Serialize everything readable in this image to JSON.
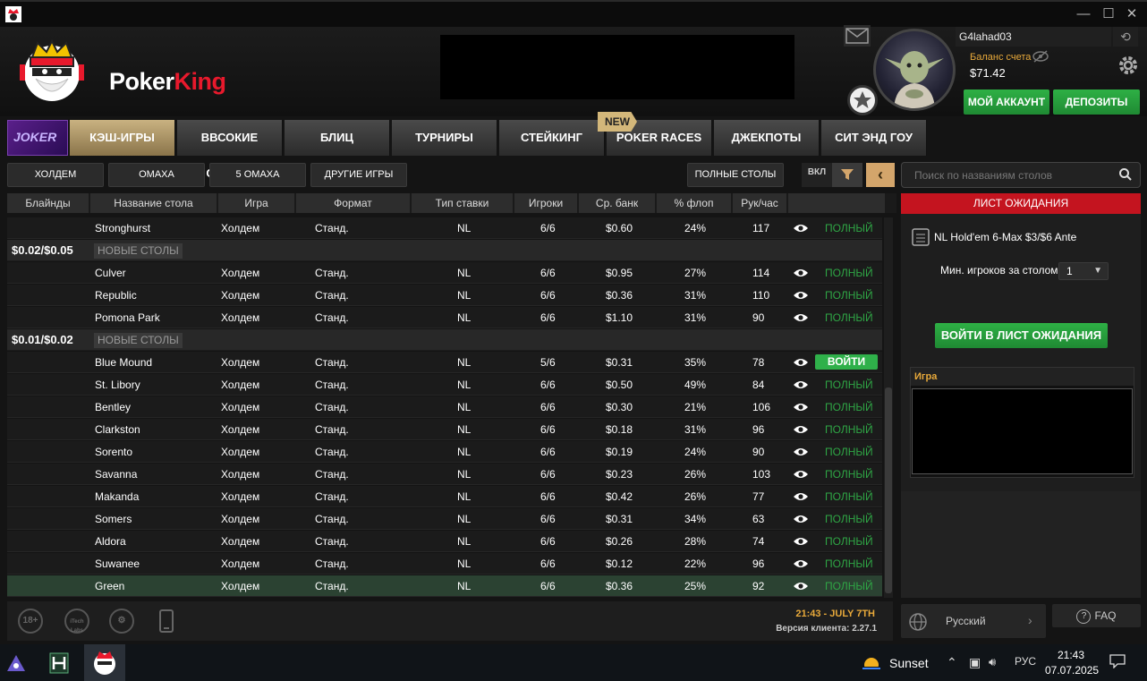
{
  "brand": {
    "name_white": "Poker",
    "name_red": "King"
  },
  "window": {
    "minimize": "—",
    "maximize": "☐",
    "close": "✕"
  },
  "account": {
    "username": "G4lahad03",
    "balance_label": "Баланс счета",
    "balance": "$71.42",
    "my_account": "МОЙ АККАУНТ",
    "deposits": "ДЕПОЗИТЫ"
  },
  "tabs": [
    {
      "label": "КЭШ-ИГРЫ",
      "active": true
    },
    {
      "label": "ВВСОКИЕ СТАВКИ"
    },
    {
      "label": "БЛИЦ"
    },
    {
      "label": "ТУРНИРЫ"
    },
    {
      "label": "СТЕЙКИНГ"
    },
    {
      "label": "POKER RACES",
      "badge": "NEW"
    },
    {
      "label": "ДЖЕКПОТЫ"
    },
    {
      "label": "СИТ ЭНД ГОУ"
    }
  ],
  "joker_label": "JOKER",
  "filters": {
    "holdem": "ХОЛДЕМ",
    "omaha": "ОМАХА",
    "omaha5": "5 ОМАХА",
    "other": "ДРУГИЕ ИГРЫ",
    "full_tables": "ПОЛНЫЕ СТОЛЫ",
    "toggle": "ВКЛ"
  },
  "search": {
    "placeholder": "Поиск по названиям столов"
  },
  "columns": [
    "Блайнды",
    "Название стола",
    "Игра",
    "Формат",
    "Тип ставки",
    "Игроки",
    "Ср. банк",
    "% флоп",
    "Рук/час"
  ],
  "groups": [
    {
      "label": "$0.02/$0.05",
      "tag": "НОВЫЕ СТОЛЫ"
    },
    {
      "label": "$0.01/$0.02",
      "tag": "НОВЫЕ СТОЛЫ"
    }
  ],
  "rows": [
    {
      "name": "Stronghurst",
      "game": "Холдем",
      "format": "Станд.",
      "type": "NL",
      "players": "6/6",
      "pot": "$0.60",
      "flop": "24%",
      "hands": "117",
      "status": "ПОЛНЫЙ"
    },
    {
      "name": "Culver",
      "game": "Холдем",
      "format": "Станд.",
      "type": "NL",
      "players": "6/6",
      "pot": "$0.95",
      "flop": "27%",
      "hands": "114",
      "status": "ПОЛНЫЙ"
    },
    {
      "name": "Republic",
      "game": "Холдем",
      "format": "Станд.",
      "type": "NL",
      "players": "6/6",
      "pot": "$0.36",
      "flop": "31%",
      "hands": "110",
      "status": "ПОЛНЫЙ"
    },
    {
      "name": "Pomona Park",
      "game": "Холдем",
      "format": "Станд.",
      "type": "NL",
      "players": "6/6",
      "pot": "$1.10",
      "flop": "31%",
      "hands": "90",
      "status": "ПОЛНЫЙ"
    },
    {
      "name": "Blue Mound",
      "game": "Холдем",
      "format": "Станд.",
      "type": "NL",
      "players": "5/6",
      "pot": "$0.31",
      "flop": "35%",
      "hands": "78",
      "status": "ВОЙТИ"
    },
    {
      "name": "St. Libory",
      "game": "Холдем",
      "format": "Станд.",
      "type": "NL",
      "players": "6/6",
      "pot": "$0.50",
      "flop": "49%",
      "hands": "84",
      "status": "ПОЛНЫЙ"
    },
    {
      "name": "Bentley",
      "game": "Холдем",
      "format": "Станд.",
      "type": "NL",
      "players": "6/6",
      "pot": "$0.30",
      "flop": "21%",
      "hands": "106",
      "status": "ПОЛНЫЙ"
    },
    {
      "name": "Clarkston",
      "game": "Холдем",
      "format": "Станд.",
      "type": "NL",
      "players": "6/6",
      "pot": "$0.18",
      "flop": "31%",
      "hands": "96",
      "status": "ПОЛНЫЙ"
    },
    {
      "name": "Sorento",
      "game": "Холдем",
      "format": "Станд.",
      "type": "NL",
      "players": "6/6",
      "pot": "$0.19",
      "flop": "24%",
      "hands": "90",
      "status": "ПОЛНЫЙ"
    },
    {
      "name": "Savanna",
      "game": "Холдем",
      "format": "Станд.",
      "type": "NL",
      "players": "6/6",
      "pot": "$0.23",
      "flop": "26%",
      "hands": "103",
      "status": "ПОЛНЫЙ"
    },
    {
      "name": "Makanda",
      "game": "Холдем",
      "format": "Станд.",
      "type": "NL",
      "players": "6/6",
      "pot": "$0.42",
      "flop": "26%",
      "hands": "77",
      "status": "ПОЛНЫЙ"
    },
    {
      "name": "Somers",
      "game": "Холдем",
      "format": "Станд.",
      "type": "NL",
      "players": "6/6",
      "pot": "$0.31",
      "flop": "34%",
      "hands": "63",
      "status": "ПОЛНЫЙ"
    },
    {
      "name": "Aldora",
      "game": "Холдем",
      "format": "Станд.",
      "type": "NL",
      "players": "6/6",
      "pot": "$0.26",
      "flop": "28%",
      "hands": "74",
      "status": "ПОЛНЫЙ"
    },
    {
      "name": "Suwanee",
      "game": "Холдем",
      "format": "Станд.",
      "type": "NL",
      "players": "6/6",
      "pot": "$0.12",
      "flop": "22%",
      "hands": "96",
      "status": "ПОЛНЫЙ"
    },
    {
      "name": "Green",
      "game": "Холдем",
      "format": "Станд.",
      "type": "NL",
      "players": "6/6",
      "pot": "$0.36",
      "flop": "25%",
      "hands": "92",
      "status": "ПОЛНЫЙ",
      "selected": true
    }
  ],
  "footer": {
    "age": "18+",
    "itech": "iTech Labs",
    "time": "21:43 - JULY 7TH",
    "version": "Версия клиента: 2.27.1"
  },
  "waitlist": {
    "title": "ЛИСТ ОЖИДАНИЯ",
    "table_name": "NL Hold'em 6-Max $3/$6 Ante",
    "min_players_label": "Мин. игроков за столом",
    "min_players_value": "1",
    "join_button": "ВОЙТИ В ЛИСТ ОЖИДАНИЯ",
    "game_header": "Игра"
  },
  "language": "Русский",
  "faq": "FAQ",
  "taskbar": {
    "weather": "Sunset",
    "lang": "РУС",
    "time": "21:43",
    "date": "07.07.2025"
  },
  "colors": {
    "accent_green": "#2fb04a",
    "accent_red": "#c4141f",
    "gold": "#e8a93a"
  }
}
